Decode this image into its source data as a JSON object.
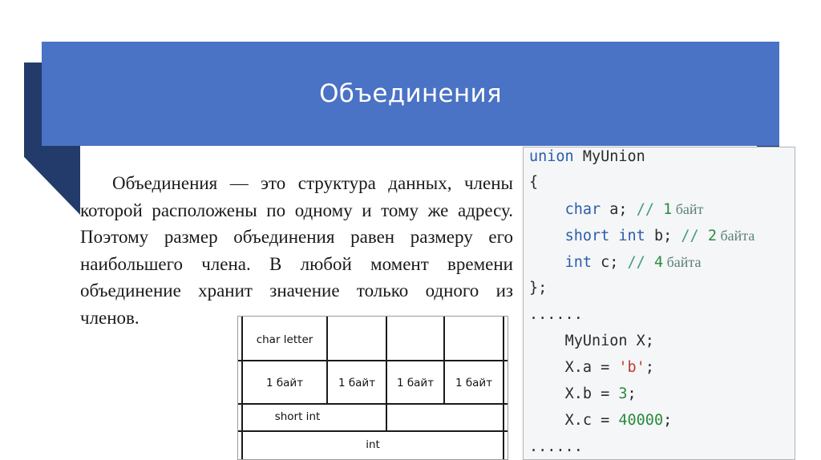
{
  "header": {
    "title": "Объединения"
  },
  "paragraph": "Объединения — это структура данных, члены которой расположены по одному и тому же адресу. Поэтому размер объединения равен размеру его наибольшего члена. В любой момент времени объединение хранит значение только одного из членов.",
  "memory_table": {
    "char_cell": "char letter",
    "byte_cells": [
      "1 байт",
      "1 байт",
      "1 байт",
      "1 байт"
    ],
    "short_cell": "short int",
    "int_cell": "int"
  },
  "code": {
    "l1_kw": "union",
    "l1_name": " MyUnion",
    "l2": "{",
    "l3_kw": "char",
    "l3_rest": " a; ",
    "l3_cm": "// ",
    "l3_num": "1",
    "l3_ru": " байт",
    "l4_kw": "short",
    "l4_kw2": "int",
    "l4_rest": " b; ",
    "l4_cm": "// ",
    "l4_num": "2",
    "l4_ru": " байта",
    "l5_kw": "int",
    "l5_rest": " c; ",
    "l5_cm": "// ",
    "l5_num": "4",
    "l5_ru": " байта",
    "l6": "};",
    "l7": "......",
    "l8": "MyUnion X;",
    "l9_a": "X.a = ",
    "l9_str": "'b'",
    "l9_end": ";",
    "l10_a": "X.b = ",
    "l10_num": "3",
    "l10_end": ";",
    "l11_a": "X.c = ",
    "l11_num": "40000",
    "l11_end": ";",
    "l12": "......"
  }
}
